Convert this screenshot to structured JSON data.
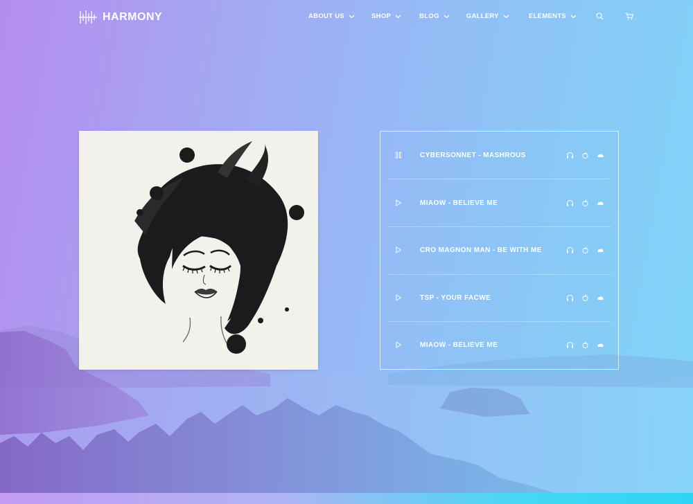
{
  "brand": {
    "name": "HARMONY"
  },
  "nav": {
    "items": [
      {
        "label": "ABOUT US"
      },
      {
        "label": "SHOP"
      },
      {
        "label": "BLOG"
      },
      {
        "label": "GALLERY"
      },
      {
        "label": "ELEMENTS"
      }
    ],
    "icons": [
      "search-icon",
      "cart-icon"
    ]
  },
  "album": {
    "art": "watercolor-woman-illustration"
  },
  "playlist": {
    "tracks": [
      {
        "title": "CYBERSONNET - MASHROUS",
        "state": "playing"
      },
      {
        "title": "MIAOW - BELIEVE ME",
        "state": "paused"
      },
      {
        "title": "CRO MAGNON MAN - BE WITH ME",
        "state": "paused"
      },
      {
        "title": "TSP - YOUR FACWE",
        "state": "paused"
      },
      {
        "title": "MIAOW - BELIEVE ME",
        "state": "paused"
      }
    ],
    "track_icons": [
      "headphones-icon",
      "apple-icon",
      "cloud-icon"
    ]
  },
  "colors": {
    "gradient_start": "#b58cf0",
    "gradient_end": "#7fd6f8",
    "text": "#ffffff"
  }
}
